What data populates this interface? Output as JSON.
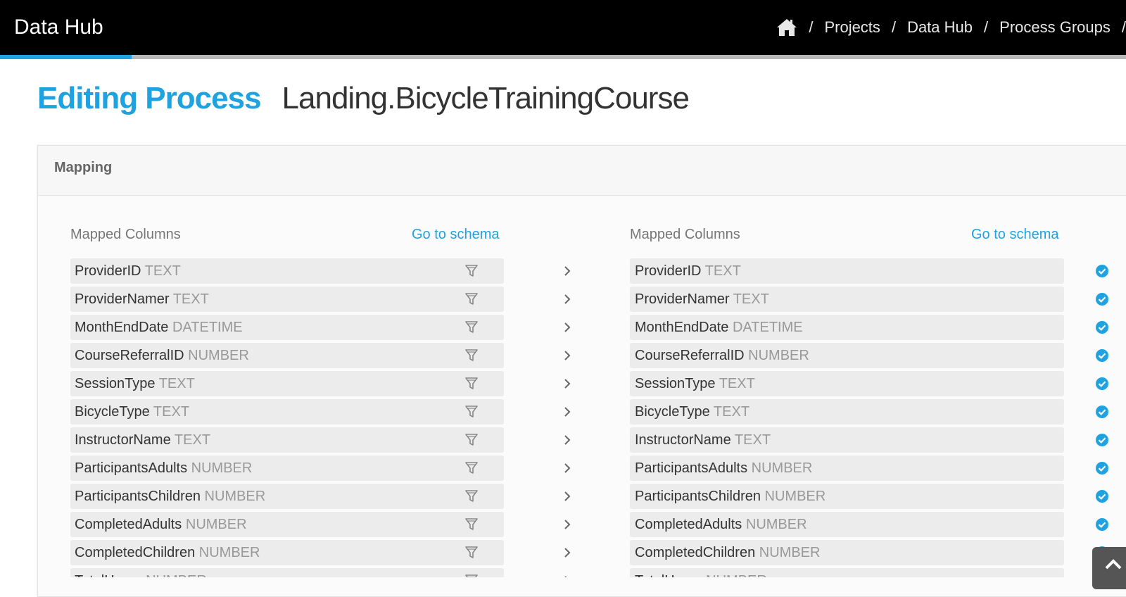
{
  "header": {
    "app_title": "Data Hub",
    "home_icon": "home-icon",
    "breadcrumb": [
      "Projects",
      "Data Hub",
      "Process Groups"
    ],
    "separator": "/",
    "progress_fraction": 0.117,
    "colors": {
      "bar": "#000000",
      "accent": "#1ea3e0"
    }
  },
  "page": {
    "title_label": "Editing Process",
    "process_name": "Landing.BicycleTrainingCourse"
  },
  "mapping": {
    "panel_title": "Mapping",
    "left": {
      "heading": "Mapped Columns",
      "schema_link": "Go to schema"
    },
    "right": {
      "heading": "Mapped Columns",
      "schema_link": "Go to schema"
    },
    "columns": [
      {
        "name": "ProviderID",
        "type": "TEXT"
      },
      {
        "name": "ProviderNamer",
        "type": "TEXT"
      },
      {
        "name": "MonthEndDate",
        "type": "DATETIME"
      },
      {
        "name": "CourseReferralID",
        "type": "NUMBER"
      },
      {
        "name": "SessionType",
        "type": "TEXT"
      },
      {
        "name": "BicycleType",
        "type": "TEXT"
      },
      {
        "name": "InstructorName",
        "type": "TEXT"
      },
      {
        "name": "ParticipantsAdults",
        "type": "NUMBER"
      },
      {
        "name": "ParticipantsChildren",
        "type": "NUMBER"
      },
      {
        "name": "CompletedAdults",
        "type": "NUMBER"
      },
      {
        "name": "CompletedChildren",
        "type": "NUMBER"
      },
      {
        "name": "TotalHours",
        "type": "NUMBER"
      }
    ],
    "icons": {
      "filter": "filter-icon",
      "arrow": "chevron-right-icon",
      "mapped": "check-circle-icon"
    }
  },
  "scroll_top": {
    "icon": "chevron-up-icon"
  }
}
